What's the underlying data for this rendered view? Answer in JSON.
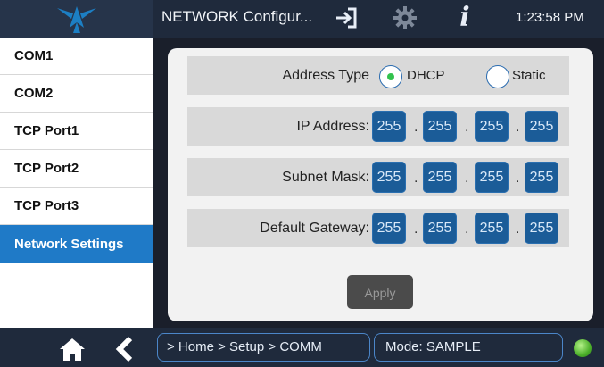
{
  "header": {
    "title": "NETWORK Configur...",
    "time": "1:23:58 PM",
    "icons": [
      "logo-icon",
      "exit-icon",
      "gear-icon",
      "info-icon"
    ]
  },
  "sidebar": {
    "items": [
      {
        "label": "COM1",
        "active": false
      },
      {
        "label": "COM2",
        "active": false
      },
      {
        "label": "TCP Port1",
        "active": false
      },
      {
        "label": "TCP Port2",
        "active": false
      },
      {
        "label": "TCP Port3",
        "active": false
      },
      {
        "label": "Network Settings",
        "active": true
      }
    ]
  },
  "form": {
    "address_type": {
      "label": "Address Type",
      "options": [
        {
          "label": "DHCP",
          "selected": true
        },
        {
          "label": "Static",
          "selected": false
        }
      ]
    },
    "ip_address": {
      "label": "IP Address:",
      "octets": [
        "255",
        "255",
        "255",
        "255"
      ]
    },
    "subnet_mask": {
      "label": "Subnet Mask:",
      "octets": [
        "255",
        "255",
        "255",
        "255"
      ]
    },
    "default_gateway": {
      "label": "Default Gateway:",
      "octets": [
        "255",
        "255",
        "255",
        "255"
      ]
    },
    "separator": ".",
    "apply_label": "Apply"
  },
  "footer": {
    "breadcrumb": "> Home > Setup > COMM",
    "mode": "Mode: SAMPLE",
    "status_color": "#4caf2a"
  },
  "colors": {
    "accent": "#1f7ac7",
    "field_blue": "#1b5c98",
    "bar_bg": "#1f2a3c"
  }
}
